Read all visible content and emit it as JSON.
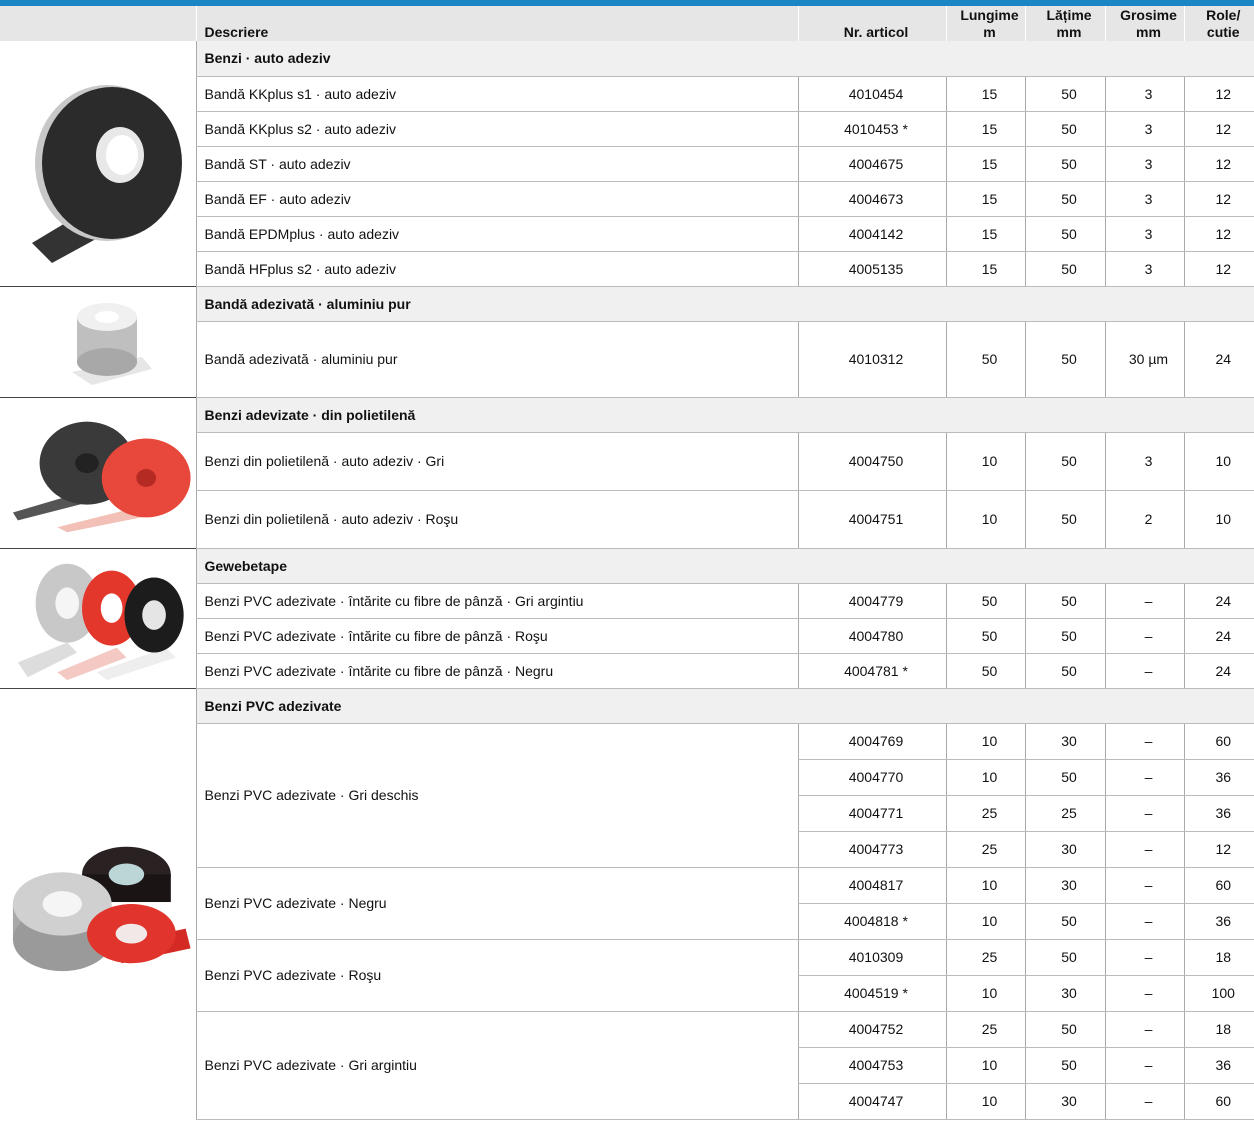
{
  "header": {
    "descriere": "Descriere",
    "nr_articol": "Nr. articol",
    "lungime": "Lungime",
    "lungime_unit": "m",
    "latime": "Lățime",
    "latime_unit": "mm",
    "grosime": "Grosime",
    "grosime_unit": "mm",
    "role": "Role/",
    "role_unit": "cutie"
  },
  "groups": [
    {
      "title": "Benzi · auto adeziv",
      "image": "black-tape-roll-icon",
      "rows": [
        {
          "desc": "Bandă KKplus s1 · auto adeziv",
          "art": "4010454",
          "l": "15",
          "w": "50",
          "g": "3",
          "r": "12"
        },
        {
          "desc": "Bandă KKplus s2 · auto adeziv",
          "art": "4010453 *",
          "l": "15",
          "w": "50",
          "g": "3",
          "r": "12"
        },
        {
          "desc": "Bandă ST · auto adeziv",
          "art": "4004675",
          "l": "15",
          "w": "50",
          "g": "3",
          "r": "12"
        },
        {
          "desc": "Bandă EF · auto adeziv",
          "art": "4004673",
          "l": "15",
          "w": "50",
          "g": "3",
          "r": "12"
        },
        {
          "desc": "Bandă EPDMplus · auto adeziv",
          "art": "4004142",
          "l": "15",
          "w": "50",
          "g": "3",
          "r": "12"
        },
        {
          "desc": "Bandă HFplus s2 · auto adeziv",
          "art": "4005135",
          "l": "15",
          "w": "50",
          "g": "3",
          "r": "12"
        }
      ]
    },
    {
      "title": "Bandă adezivată · aluminiu pur",
      "image": "aluminium-tape-roll-icon",
      "rows": [
        {
          "desc": "Bandă adezivată · aluminiu pur",
          "art": "4010312",
          "l": "50",
          "w": "50",
          "g": "30 µm",
          "r": "24"
        }
      ]
    },
    {
      "title": "Benzi adevizate · din polietilenă",
      "image": "polyethylene-tape-rolls-icon",
      "rows": [
        {
          "desc": "Benzi din polietilenă · auto adeziv · Gri",
          "art": "4004750",
          "l": "10",
          "w": "50",
          "g": "3",
          "r": "10"
        },
        {
          "desc": "Benzi din polietilenă · auto adeziv · Roşu",
          "art": "4004751",
          "l": "10",
          "w": "50",
          "g": "2",
          "r": "10"
        }
      ]
    },
    {
      "title": "Gewebetape",
      "image": "cloth-tape-rolls-icon",
      "rows": [
        {
          "desc": "Benzi PVC adezivate · întărite cu fibre de pânză · Gri argintiu",
          "art": "4004779",
          "l": "50",
          "w": "50",
          "g": "–",
          "r": "24"
        },
        {
          "desc": "Benzi PVC adezivate · întărite cu fibre de pânză · Roşu",
          "art": "4004780",
          "l": "50",
          "w": "50",
          "g": "–",
          "r": "24"
        },
        {
          "desc": "Benzi PVC adezivate · întărite cu fibre de pânză · Negru",
          "art": "4004781 *",
          "l": "50",
          "w": "50",
          "g": "–",
          "r": "24"
        }
      ]
    },
    {
      "title": "Benzi PVC adezivate",
      "image": "pvc-tape-rolls-icon",
      "subgroups": [
        {
          "desc": "Benzi PVC adezivate · Gri deschis",
          "rows": [
            {
              "art": "4004769",
              "l": "10",
              "w": "30",
              "g": "–",
              "r": "60"
            },
            {
              "art": "4004770",
              "l": "10",
              "w": "50",
              "g": "–",
              "r": "36"
            },
            {
              "art": "4004771",
              "l": "25",
              "w": "25",
              "g": "–",
              "r": "36"
            },
            {
              "art": "4004773",
              "l": "25",
              "w": "30",
              "g": "–",
              "r": "12"
            }
          ]
        },
        {
          "desc": "Benzi PVC adezivate · Negru",
          "rows": [
            {
              "art": "4004817",
              "l": "10",
              "w": "30",
              "g": "–",
              "r": "60"
            },
            {
              "art": "4004818 *",
              "l": "10",
              "w": "50",
              "g": "–",
              "r": "36"
            }
          ]
        },
        {
          "desc": "Benzi PVC adezivate · Roşu",
          "rows": [
            {
              "art": "4010309",
              "l": "25",
              "w": "50",
              "g": "–",
              "r": "18"
            },
            {
              "art": "4004519 *",
              "l": "10",
              "w": "30",
              "g": "–",
              "r": "100"
            }
          ]
        },
        {
          "desc": "Benzi PVC adezivate · Gri argintiu",
          "rows": [
            {
              "art": "4004752",
              "l": "25",
              "w": "50",
              "g": "–",
              "r": "18"
            },
            {
              "art": "4004753",
              "l": "10",
              "w": "50",
              "g": "–",
              "r": "36"
            },
            {
              "art": "4004747",
              "l": "10",
              "w": "30",
              "g": "–",
              "r": "60"
            }
          ]
        }
      ]
    }
  ]
}
